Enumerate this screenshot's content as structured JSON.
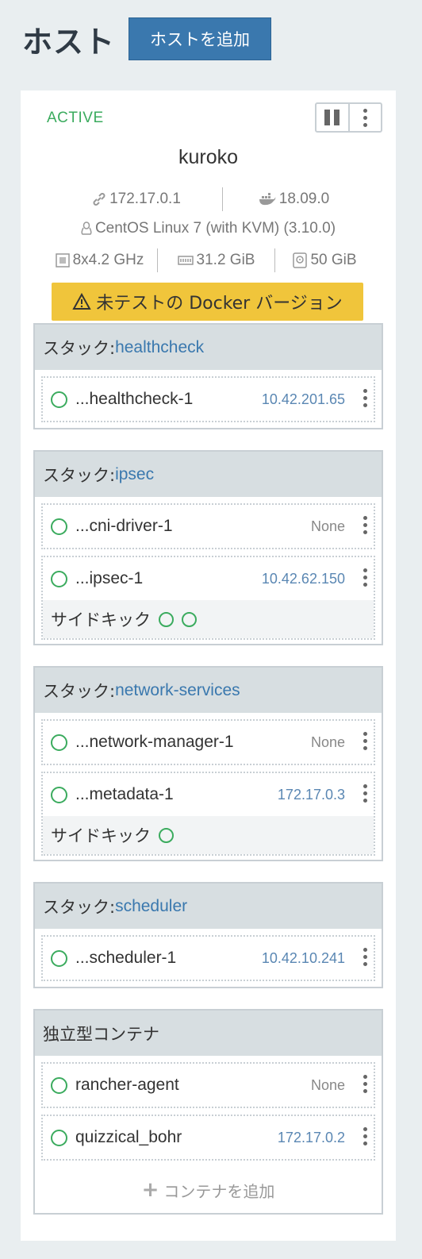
{
  "header": {
    "title": "ホスト",
    "add_host_label": "ホストを追加"
  },
  "host": {
    "state": "ACTIVE",
    "name": "kuroko",
    "ip": "172.17.0.1",
    "docker_version": "18.09.0",
    "os": "CentOS Linux 7 (with KVM) (3.10.0)",
    "cpu": "8x4.2 GHz",
    "memory": "31.2 GiB",
    "storage": "50 GiB",
    "warning": "未テストの Docker バージョン",
    "icons": [
      "link-icon",
      "docker-icon",
      "linux-icon",
      "cpu-icon",
      "memory-icon",
      "disk-icon",
      "warning-icon",
      "pause-icon",
      "kebab-icon"
    ]
  },
  "stack_prefix": "スタック:",
  "stacks": [
    {
      "name": "healthcheck",
      "containers": [
        {
          "name": "...healthcheck-1",
          "ip": "10.42.201.65"
        }
      ]
    },
    {
      "name": "ipsec",
      "containers": [
        {
          "name": "...cni-driver-1",
          "ip": "None"
        },
        {
          "name": "...ipsec-1",
          "ip": "10.42.62.150"
        }
      ]
    },
    {
      "name": "network-services",
      "containers": [
        {
          "name": "...network-manager-1",
          "ip": "None"
        },
        {
          "name": "...metadata-1",
          "ip": "172.17.0.3"
        }
      ]
    },
    {
      "name": "scheduler",
      "containers": [
        {
          "name": "...scheduler-1",
          "ip": "10.42.10.241"
        }
      ]
    }
  ],
  "sidekick_label": "サイドキック",
  "standalone": {
    "title": "独立型コンテナ",
    "containers": [
      {
        "name": "rancher-agent",
        "ip": "None"
      },
      {
        "name": "quizzical_bohr",
        "ip": "172.17.0.2"
      }
    ],
    "add_label": "コンテナを追加"
  },
  "colors": {
    "active": "#3bab5e",
    "primary": "#3a78ae",
    "warning": "#f0c53b"
  }
}
